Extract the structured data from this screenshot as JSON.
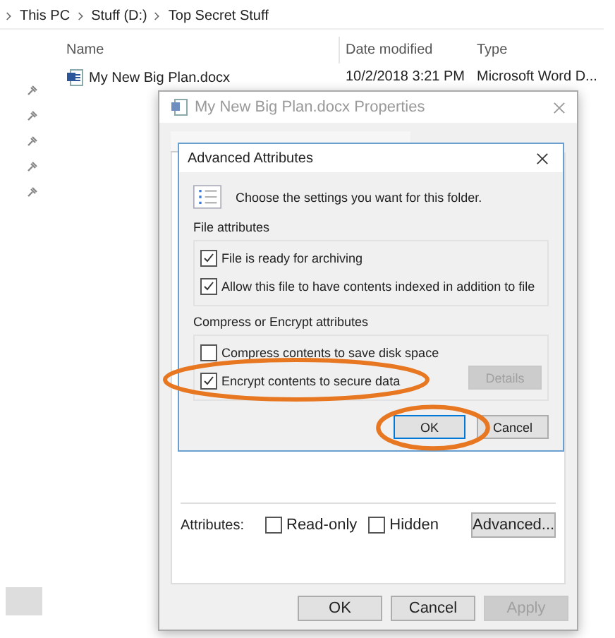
{
  "breadcrumb": [
    "This PC",
    "Stuff (D:)",
    "Top Secret Stuff"
  ],
  "columns": [
    "Name",
    "Date modified",
    "Type"
  ],
  "files": [
    {
      "name": "My New Big Plan.docx",
      "date": "10/2/2018 3:21 PM",
      "type": "Microsoft Word D..."
    }
  ],
  "properties": {
    "title": "My New Big Plan.docx Properties",
    "attributes_label": "Attributes:",
    "attributes": [
      {
        "label": "Read-only",
        "checked": false
      },
      {
        "label": "Hidden",
        "checked": false
      }
    ],
    "advanced_button": "Advanced...",
    "buttons": [
      {
        "label": "OK",
        "disabled": false
      },
      {
        "label": "Cancel",
        "disabled": false
      },
      {
        "label": "Apply",
        "disabled": true
      }
    ]
  },
  "advanced": {
    "title": "Advanced Attributes",
    "description": "Choose the settings you want for this folder.",
    "groups": [
      {
        "title": "File attributes",
        "options": [
          {
            "label": "File is ready for archiving",
            "checked": true
          },
          {
            "label": "Allow this file to have contents indexed in addition to file",
            "checked": true
          }
        ]
      },
      {
        "title": "Compress or Encrypt attributes",
        "options": [
          {
            "label": "Compress contents to save disk space",
            "checked": false
          },
          {
            "label": "Encrypt contents to secure data",
            "checked": true
          }
        ],
        "button": {
          "label": "Details",
          "disabled": true
        }
      }
    ],
    "buttons": [
      {
        "label": "OK",
        "default": true
      },
      {
        "label": "Cancel",
        "default": false
      }
    ]
  }
}
